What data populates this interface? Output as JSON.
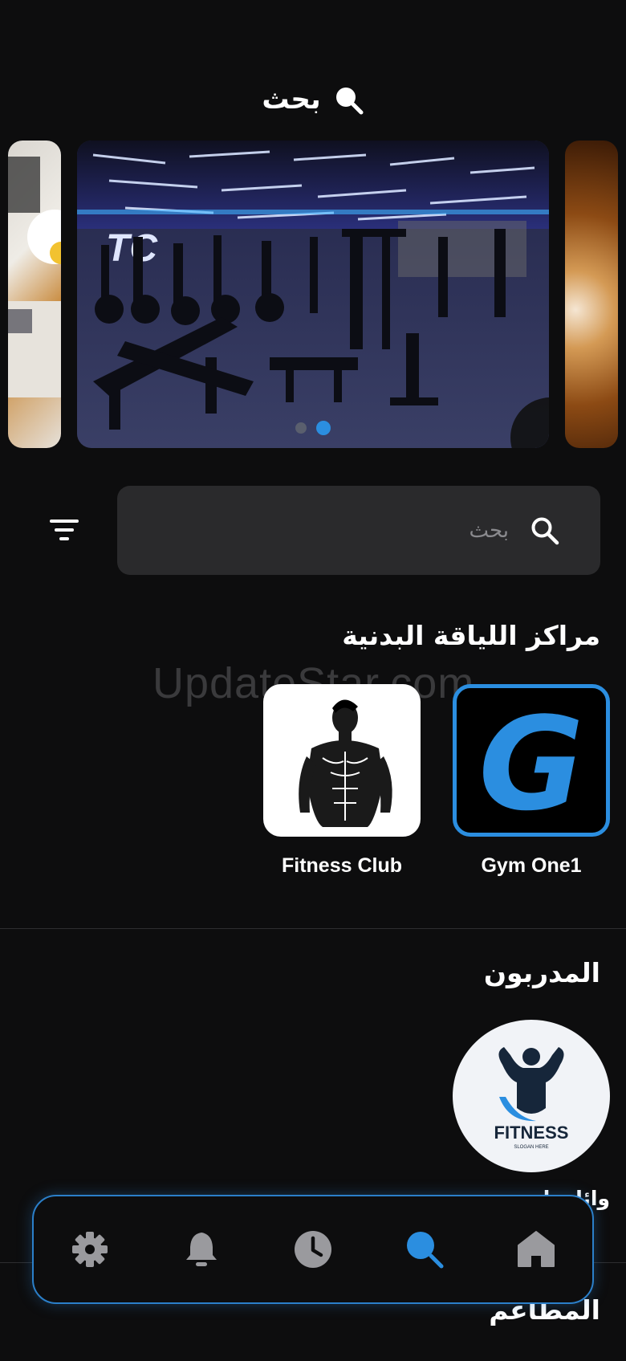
{
  "header": {
    "title": "بحث",
    "icon": "search-icon"
  },
  "carousel": {
    "slide_count": 2,
    "active_index": 1
  },
  "search": {
    "placeholder": "بحث",
    "value": "",
    "icon": "search-icon",
    "filter_icon": "filter-icon"
  },
  "sections": {
    "fitness_centers": {
      "title": "مراكز اللياقة البدنية",
      "items": [
        {
          "name": "Gym One1",
          "logo": "g-letter-logo"
        },
        {
          "name": "Fitness Club",
          "logo": "bodybuilder-logo"
        }
      ]
    },
    "trainers": {
      "title": "المدربون",
      "items": [
        {
          "name": "وائل ناصر",
          "logo_text": "FITNESS",
          "logo_subtext": "SLOGAN HERE"
        }
      ]
    },
    "restaurants": {
      "title": "المطاعم"
    }
  },
  "watermark": "UpdateStar.com",
  "bottom_nav": {
    "items": [
      {
        "icon": "settings-icon",
        "active": false
      },
      {
        "icon": "bell-icon",
        "active": false
      },
      {
        "icon": "clock-icon",
        "active": false
      },
      {
        "icon": "search-icon",
        "active": true
      },
      {
        "icon": "home-icon",
        "active": false
      }
    ]
  },
  "colors": {
    "accent": "#2b8ee0",
    "background": "#0d0d0e",
    "surface": "#2a2a2c",
    "inactive_icon": "#9a9a9e"
  }
}
